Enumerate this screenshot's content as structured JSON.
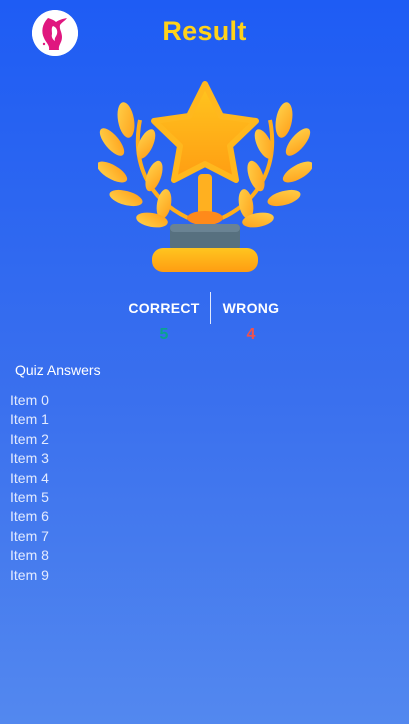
{
  "header": {
    "title": "Result",
    "logo_icon": "woman-profile-logo-icon"
  },
  "trophy_icon": "trophy-star-laurel-icon",
  "scores": {
    "correct_label": "CORRECT",
    "correct_value": "5",
    "wrong_label": "WRONG",
    "wrong_value": "4"
  },
  "quiz": {
    "section_title": "Quiz Answers",
    "items": [
      "Item 0",
      "Item 1",
      "Item 2",
      "Item 3",
      "Item 4",
      "Item 5",
      "Item 6",
      "Item 7",
      "Item 8",
      "Item 9"
    ]
  },
  "colors": {
    "background_top": "#1e5cf4",
    "background_bottom": "#5388ef",
    "title": "#ffd21a",
    "correct": "#0aa38f",
    "wrong": "#f2524b"
  }
}
